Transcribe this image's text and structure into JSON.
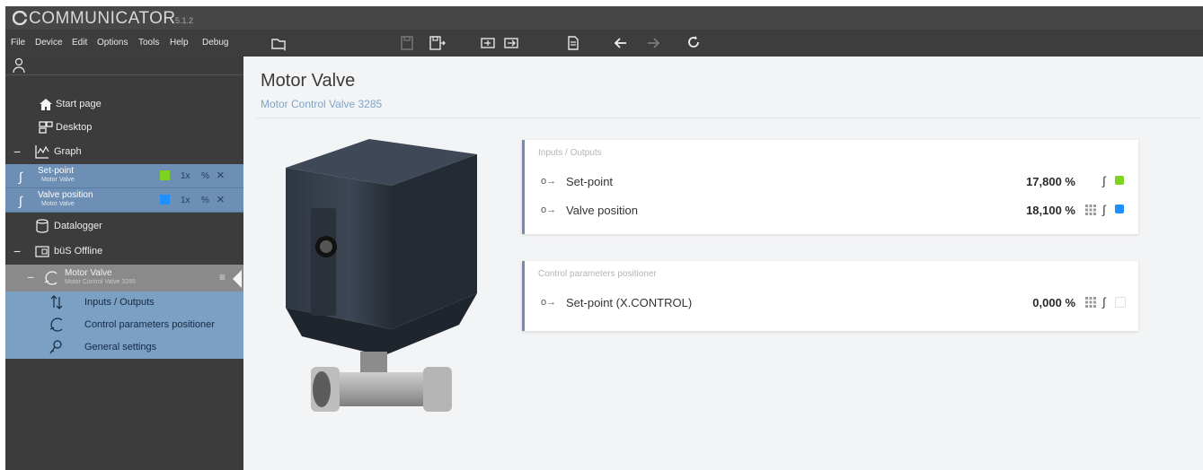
{
  "app": {
    "title": "COMMUNICATOR",
    "version": "5.1.2"
  },
  "menu": [
    "File",
    "Device",
    "Edit",
    "Options",
    "Tools",
    "Help",
    "Debug"
  ],
  "toolbar": [
    "open-device-icon",
    "save-icon",
    "save-as-icon",
    "import-icon",
    "export-icon",
    "report-icon",
    "back-icon",
    "forward-icon",
    "refresh-icon"
  ],
  "sidebar": {
    "start_page": "Start page",
    "desktop": "Desktop",
    "graph": "Graph",
    "graph_items": [
      {
        "label": "Set-point",
        "sub": "Motor Valve",
        "color": "#7ed321",
        "multiplier": "1x",
        "pct": "%"
      },
      {
        "label": "Valve position",
        "sub": "Motor Valve",
        "color": "#1e90ff",
        "multiplier": "1x",
        "pct": "%"
      }
    ],
    "datalogger": "Datalogger",
    "bus": "büS Offline",
    "device": {
      "label": "Motor Valve",
      "sub": "Motor Control Valve 3285"
    },
    "subitems": [
      "Inputs / Outputs",
      "Control parameters positioner",
      "General settings"
    ]
  },
  "main": {
    "title": "Motor Valve",
    "subtitle": "Motor Control Valve 3285",
    "cards": [
      {
        "title": "Inputs / Outputs",
        "rows": [
          {
            "label": "Set-point",
            "value": "17,800 %",
            "color": "#7ed321"
          },
          {
            "label": "Valve position",
            "value": "18,100 %",
            "color": "#1e90ff"
          }
        ]
      },
      {
        "title": "Control parameters positioner",
        "rows": [
          {
            "label": "Set-point (X.CONTROL)",
            "value": "0,000 %",
            "color": "#ffffff"
          }
        ]
      }
    ]
  }
}
